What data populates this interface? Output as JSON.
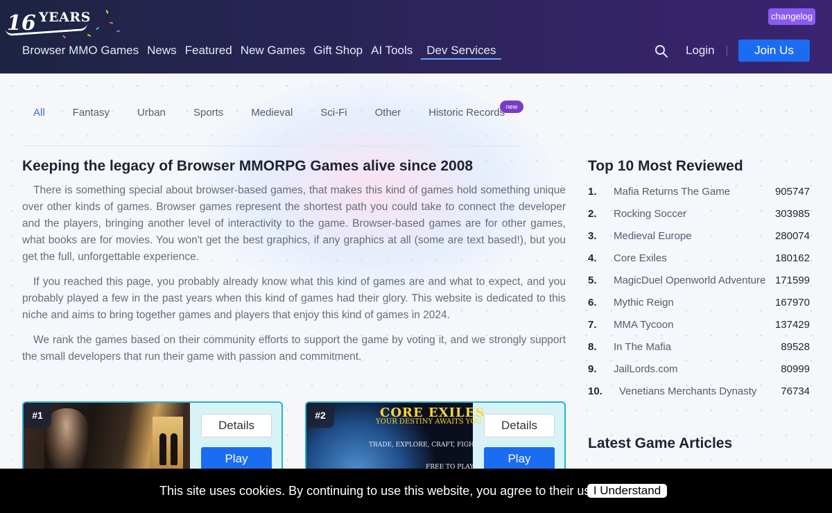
{
  "header": {
    "logo": {
      "number": "16",
      "label": "YEARS"
    },
    "changelog": "changelog",
    "nav": [
      {
        "label": "Browser MMO Games"
      },
      {
        "label": "News"
      },
      {
        "label": "Featured"
      },
      {
        "label": "New Games"
      },
      {
        "label": "Gift Shop"
      },
      {
        "label": "AI Tools"
      },
      {
        "label": "Dev Services"
      }
    ],
    "login": "Login",
    "join": "Join Us"
  },
  "categories": {
    "tabs": [
      "All",
      "Fantasy",
      "Urban",
      "Sports",
      "Medieval",
      "Sci-Fi",
      "Other",
      "Historic Records"
    ],
    "badge": "new",
    "active": "All"
  },
  "article": {
    "title": "Keeping the legacy of Browser MMORPG Games alive since 2008",
    "paragraphs": [
      "There is something special about browser-based games, that makes this kind of games hold something unique over other kinds of games. Browser games represent the shortest path you could take to connect the developer and the players, bringing another level of interactivity to the game. Browser-based games are for other games, what books are for movies. You won't get the best graphics, if any graphics at all (some are text based!), but you get the full, unforgettable experience.",
      "If you reached this page, you probably already know what this kind of games are and what to expect, and you probably played a few in the past years when this kind of games had their glory. This website is dedicated to this niche and aims to bring together games and players that enjoy this kind of games in 2024.",
      "We rank the games based on their community efforts to support the game by voting it, and we strongly support the small developers that run their game with passion and commitment."
    ]
  },
  "cards": [
    {
      "rank": "#1",
      "details": "Details",
      "play": "Play"
    },
    {
      "rank": "#2",
      "details": "Details",
      "play": "Play",
      "banner": {
        "title": "CORE EXILES",
        "subtitle": "YOUR DESTINY AWAITS YOU...",
        "tagline": "TRADE, EXPLORE, CRAFT, FIGHT",
        "free": "FREE TO PLAY"
      }
    }
  ],
  "sidebar": {
    "top_title": "Top 10 Most Reviewed",
    "top": [
      {
        "num": "1.",
        "name": "Mafia Returns The Game",
        "votes": "905747"
      },
      {
        "num": "2.",
        "name": "Rocking Soccer",
        "votes": "303985"
      },
      {
        "num": "3.",
        "name": "Medieval Europe",
        "votes": "280074"
      },
      {
        "num": "4.",
        "name": "Core Exiles",
        "votes": "180162"
      },
      {
        "num": "5.",
        "name": "MagicDuel Openworld Adventure",
        "votes": "171599"
      },
      {
        "num": "6.",
        "name": "Mythic Reign",
        "votes": "167970"
      },
      {
        "num": "7.",
        "name": "MMA Tycoon",
        "votes": "137429"
      },
      {
        "num": "8.",
        "name": "In The Mafia",
        "votes": "89528"
      },
      {
        "num": "9.",
        "name": "JailLords.com",
        "votes": "80999"
      },
      {
        "num": "10.",
        "name": "Venetians Merchants Dynasty",
        "votes": "76734"
      }
    ],
    "articles_title": "Latest Game Articles"
  },
  "cookie": {
    "text": "This site uses cookies. By continuing to use this website, you agree to their use.",
    "button": "I Understand"
  },
  "colors": {
    "accent": "#1a6df0",
    "badge": "#7a3cc8",
    "changelog": "#8b5bf0",
    "card_border": "#22b1d6"
  }
}
